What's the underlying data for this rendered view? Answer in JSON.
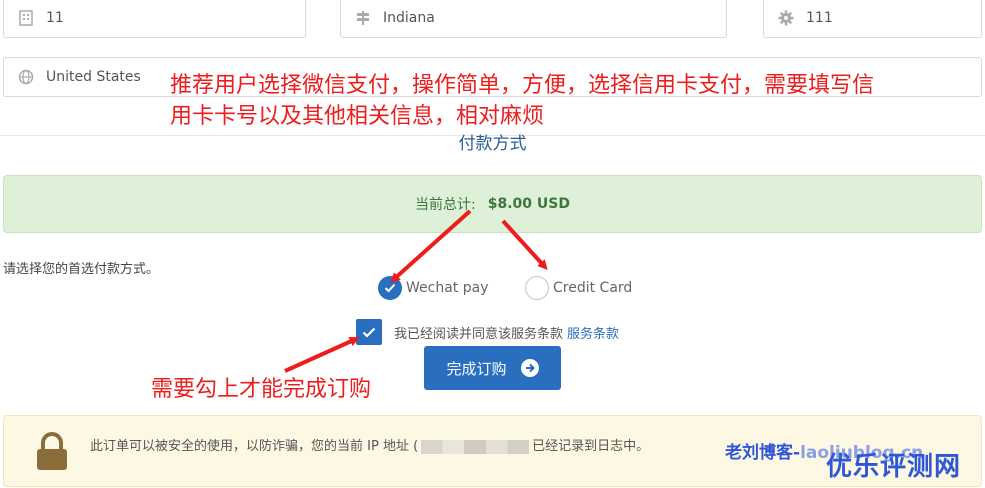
{
  "address": {
    "building": "11",
    "state": "Indiana",
    "postcode": "111",
    "country": "United States"
  },
  "payment": {
    "section_title": "付款方式",
    "total_label": "当前总计:",
    "total_amount": "$8.00 USD",
    "choose_prompt": "请选择您的首选付款方式。",
    "options": [
      {
        "label": "Wechat pay",
        "selected": true
      },
      {
        "label": "Credit Card",
        "selected": false
      }
    ],
    "tos_text": "我已经阅读并同意该服务条款",
    "tos_link": "服务条款",
    "tos_checked": true,
    "complete_button": "完成订购"
  },
  "security_notice": {
    "before_ip": "此订单可以被安全的使用，以防诈骗，您的当前 IP 地址 (",
    "after_ip": "已经记录到日志中。"
  },
  "annotations": {
    "top_note_line1": "推荐用户选择微信支付，操作简单，方便，选择信用卡支付，需要填写信",
    "top_note_line2": "用卡卡号以及其他相关信息，相对麻烦",
    "bottom_note": "需要勾上才能完成订购"
  },
  "watermark": {
    "line1_main": "老刘博客-",
    "line1_faded": "laoliublog.cn",
    "line2": "优乐评测网"
  },
  "colors": {
    "primary": "#2a6ebf",
    "success_bg": "#dff0d8",
    "warning_bg": "#fcf8e3",
    "annotation_red": "#ee1c1c",
    "watermark_blue": "#2f56d8"
  }
}
